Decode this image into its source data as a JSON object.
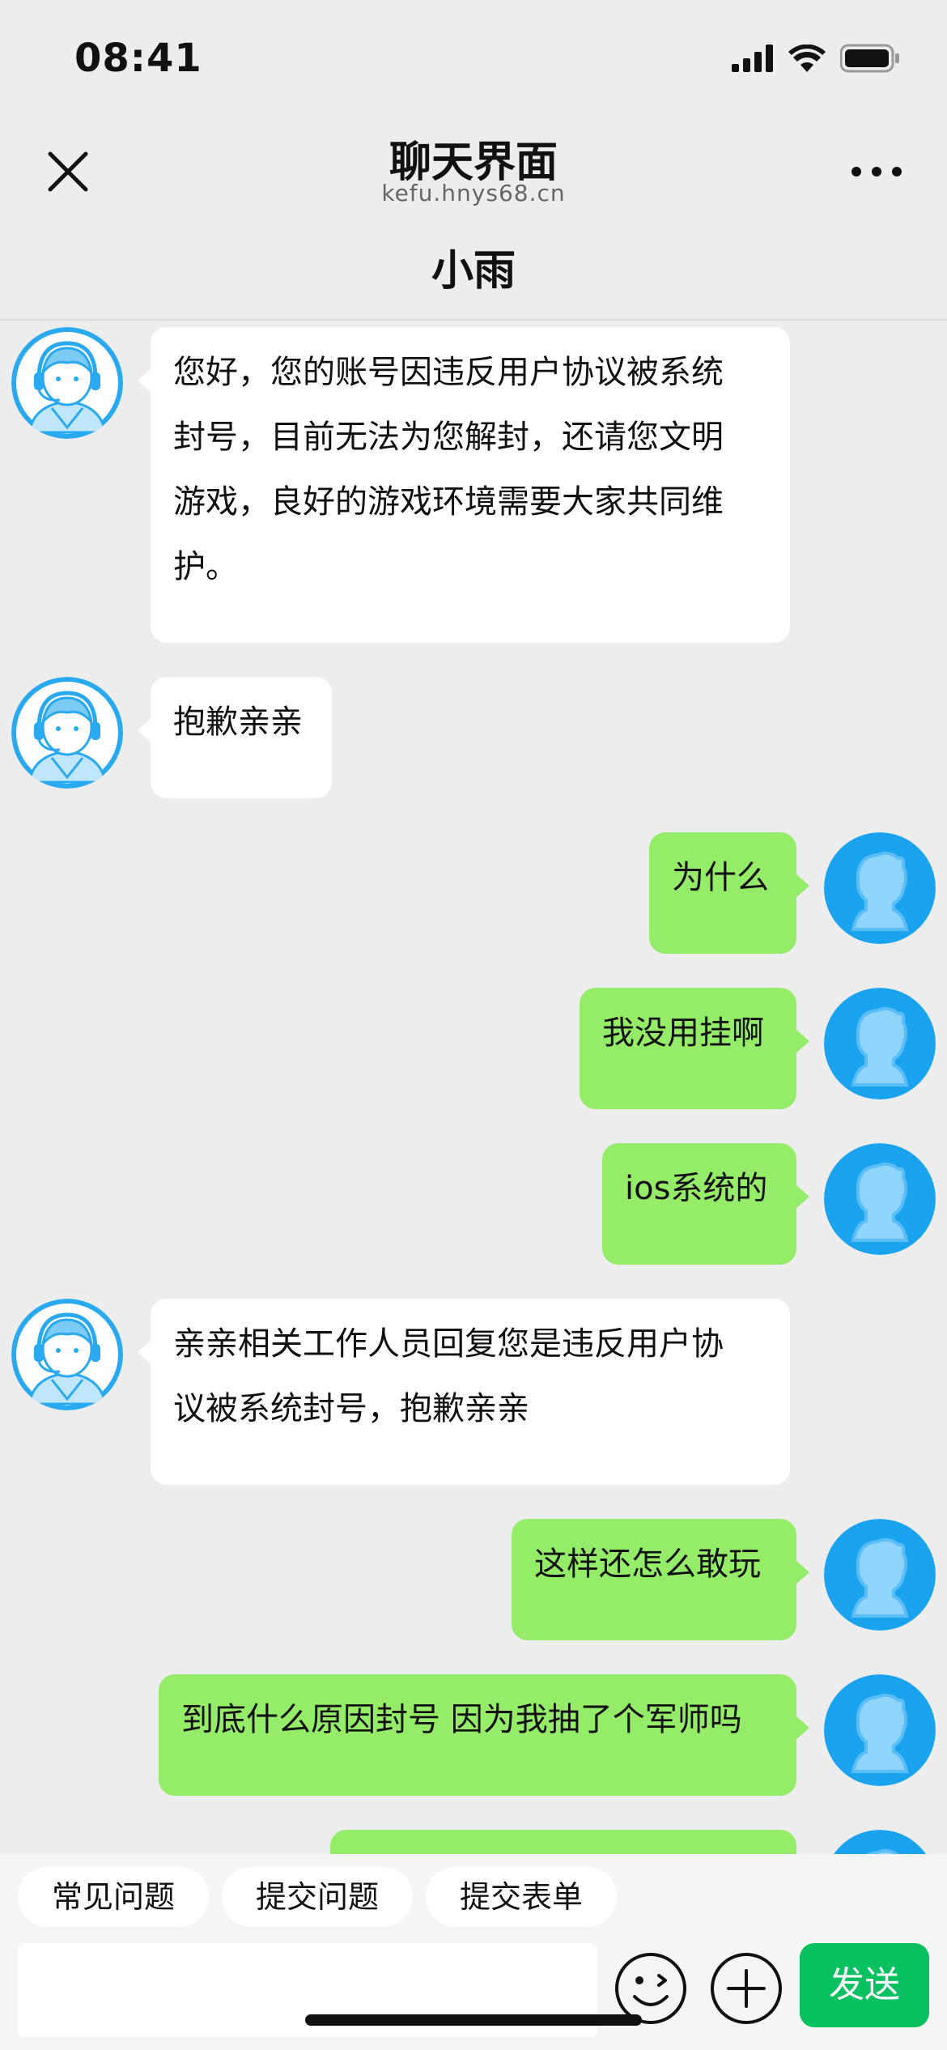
{
  "status": {
    "time": "08:41"
  },
  "header": {
    "title": "聊天界面",
    "subtitle": "kefu.hnys68.cn"
  },
  "agent": {
    "name": "小雨"
  },
  "messages": [
    {
      "from": "agent",
      "text": "您好，您的账号因违反用户协议被系统\n封号，目前无法为您解封，还请您文明\n游戏，良好的游戏环境需要大家共同维\n护。"
    },
    {
      "from": "agent",
      "text": "抱歉亲亲"
    },
    {
      "from": "user",
      "text": "为什么"
    },
    {
      "from": "user",
      "text": "我没用挂啊"
    },
    {
      "from": "user",
      "text": "ios系统的"
    },
    {
      "from": "agent",
      "text": "亲亲相关工作人员回复您是违反用户协\n议被系统封号，抱歉亲亲"
    },
    {
      "from": "user",
      "text": "这样还怎么敢玩"
    },
    {
      "from": "user",
      "text": "到底什么原因封号 因为我抽了个军师吗"
    },
    {
      "from": "user",
      "text": ""
    }
  ],
  "quick_actions": [
    "常见问题",
    "提交问题",
    "提交表单"
  ],
  "input": {
    "value": "",
    "placeholder": ""
  },
  "send_label": "发送",
  "icons": {
    "close": "close-icon",
    "more": "more-icon",
    "emoji": "emoji-icon",
    "plus": "plus-icon",
    "agent_avatar": "support-agent-avatar",
    "user_avatar": "user-avatar"
  },
  "colors": {
    "background": "#ededed",
    "bubble_in": "#ffffff",
    "bubble_out": "#95ec69",
    "send_button": "#07c160",
    "avatar_blue": "#29a9f0"
  }
}
